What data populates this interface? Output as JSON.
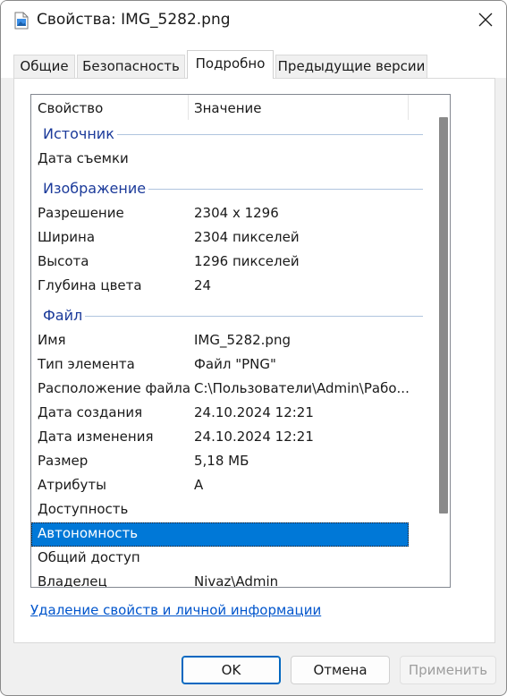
{
  "window": {
    "title": "Свойства: IMG_5282.png"
  },
  "tabs": [
    {
      "label": "Общие",
      "active": false
    },
    {
      "label": "Безопасность",
      "active": false
    },
    {
      "label": "Подробно",
      "active": true
    },
    {
      "label": "Предыдущие версии",
      "active": false
    }
  ],
  "list": {
    "header": {
      "property": "Свойство",
      "value": "Значение"
    },
    "groups": {
      "source": "Источник",
      "image": "Изображение",
      "file": "Файл"
    },
    "rows": {
      "date_taken": {
        "property": "Дата съемки",
        "value": ""
      },
      "resolution": {
        "property": "Разрешение",
        "value": "2304 x 1296"
      },
      "width": {
        "property": "Ширина",
        "value": "2304 пикселей"
      },
      "height": {
        "property": "Высота",
        "value": "1296 пикселей"
      },
      "bit_depth": {
        "property": "Глубина цвета",
        "value": "24"
      },
      "name": {
        "property": "Имя",
        "value": "IMG_5282.png"
      },
      "item_type": {
        "property": "Тип элемента",
        "value": "Файл \"PNG\""
      },
      "location": {
        "property": "Расположение файла",
        "value": "C:\\Пользователи\\Admin\\Рабо..."
      },
      "created": {
        "property": "Дата создания",
        "value": "24.10.2024 12:21"
      },
      "modified": {
        "property": "Дата изменения",
        "value": "24.10.2024 12:21"
      },
      "size": {
        "property": "Размер",
        "value": "5,18 МБ"
      },
      "attributes": {
        "property": "Атрибуты",
        "value": "A"
      },
      "availability": {
        "property": "Доступность",
        "value": ""
      },
      "offline": {
        "property": "Автономность",
        "value": "",
        "selected": true
      },
      "shared": {
        "property": "Общий доступ",
        "value": ""
      },
      "owner": {
        "property": "Владелец",
        "value": "Nivaz\\Admin"
      }
    }
  },
  "remove_properties_link": "Удаление свойств и личной информации",
  "buttons": {
    "ok": "OK",
    "cancel": "Отмена",
    "apply": "Применить"
  },
  "colors": {
    "selection": "#0078d7",
    "group_text": "#1b3a9a",
    "link": "#0055cc"
  }
}
